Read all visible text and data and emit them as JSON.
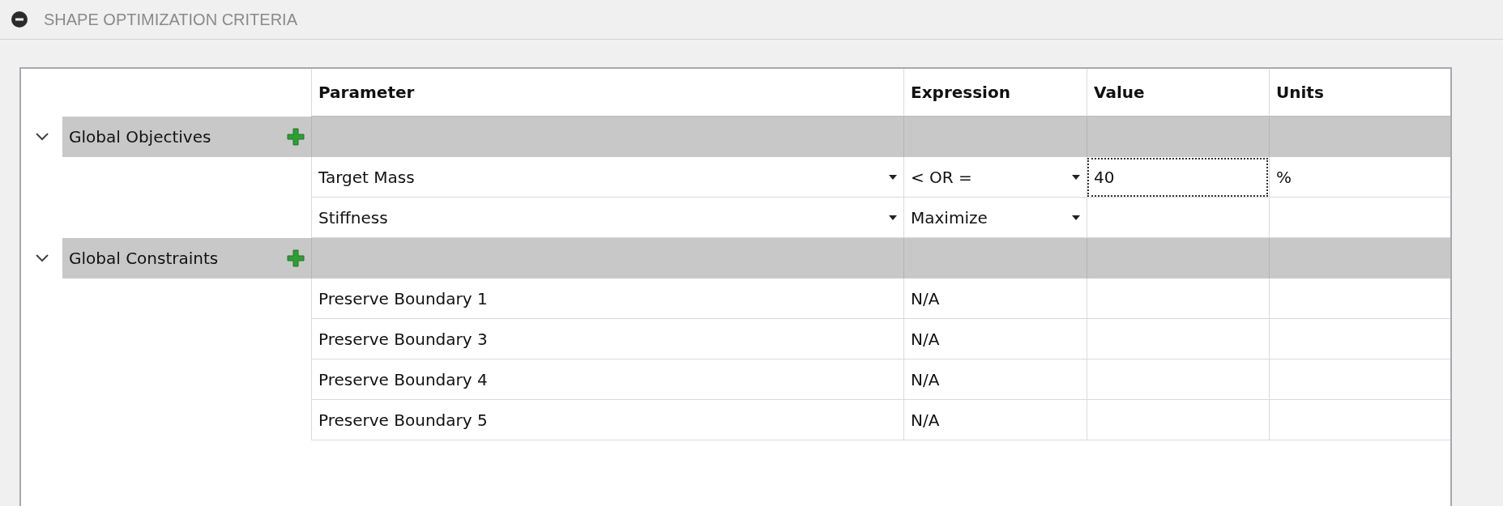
{
  "section": {
    "title": "SHAPE OPTIMIZATION CRITERIA",
    "expanded": true
  },
  "table": {
    "columns": [
      "Parameter",
      "Expression",
      "Value",
      "Units"
    ],
    "groups": [
      {
        "label": "Global Objectives",
        "expanded": true,
        "rows": [
          {
            "parameter": {
              "text": "Target Mass",
              "kind": "dropdown"
            },
            "expression": {
              "text": "< OR =",
              "kind": "dropdown"
            },
            "value": "40",
            "value_selected": true,
            "units": "%"
          },
          {
            "parameter": {
              "text": "Stiffness",
              "kind": "dropdown"
            },
            "expression": {
              "text": "Maximize",
              "kind": "dropdown"
            },
            "value_selected": false
          }
        ]
      },
      {
        "label": "Global Constraints",
        "expanded": true,
        "rows": [
          {
            "parameter": {
              "text": "Preserve Boundary 1",
              "kind": "text"
            },
            "expression": {
              "text": "N/A",
              "kind": "text"
            },
            "value_selected": false
          },
          {
            "parameter": {
              "text": "Preserve Boundary 3",
              "kind": "text"
            },
            "expression": {
              "text": "N/A",
              "kind": "text"
            },
            "value_selected": false
          },
          {
            "parameter": {
              "text": "Preserve Boundary 4",
              "kind": "text"
            },
            "expression": {
              "text": "N/A",
              "kind": "text"
            },
            "value_selected": false
          },
          {
            "parameter": {
              "text": "Preserve Boundary 5",
              "kind": "text"
            },
            "expression": {
              "text": "N/A",
              "kind": "text"
            },
            "value_selected": false
          }
        ]
      }
    ]
  }
}
